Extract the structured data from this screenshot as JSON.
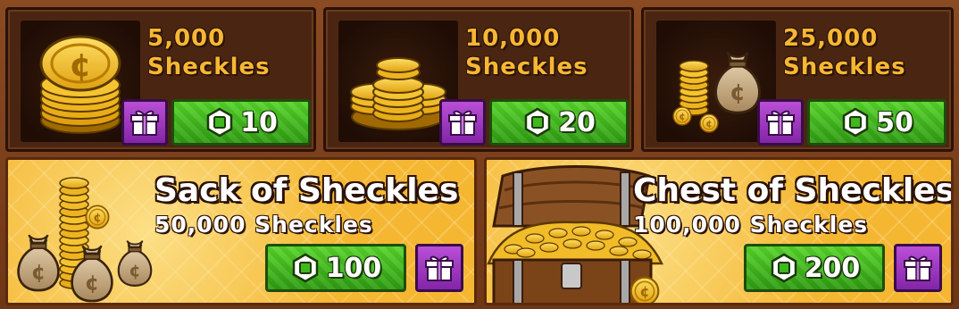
{
  "colors": {
    "frame": "#7a3f1c",
    "card_bg": "#4a2612",
    "amount_text": "#f7b733",
    "buy_green": "#3fb81c",
    "gift_purple": "#9a35be",
    "featured_gold": "#f5b731"
  },
  "offers": [
    {
      "amount": "5,000",
      "unit": "Sheckles",
      "price": "10",
      "icon": "coin-stack-icon"
    },
    {
      "amount": "10,000",
      "unit": "Sheckles",
      "price": "20",
      "icon": "coin-pile-icon"
    },
    {
      "amount": "25,000",
      "unit": "Sheckles",
      "price": "50",
      "icon": "coin-sack-icon"
    }
  ],
  "featured": [
    {
      "title": "Sack of Sheckles",
      "subtitle": "50,000 Sheckles",
      "price": "100",
      "icon": "sacks-of-coins-icon"
    },
    {
      "title": "Chest of Sheckles",
      "subtitle": "100,000 Sheckles",
      "price": "200",
      "icon": "treasure-chest-icon"
    }
  ],
  "icons": {
    "gift": "gift-icon",
    "currency": "robux-icon"
  }
}
